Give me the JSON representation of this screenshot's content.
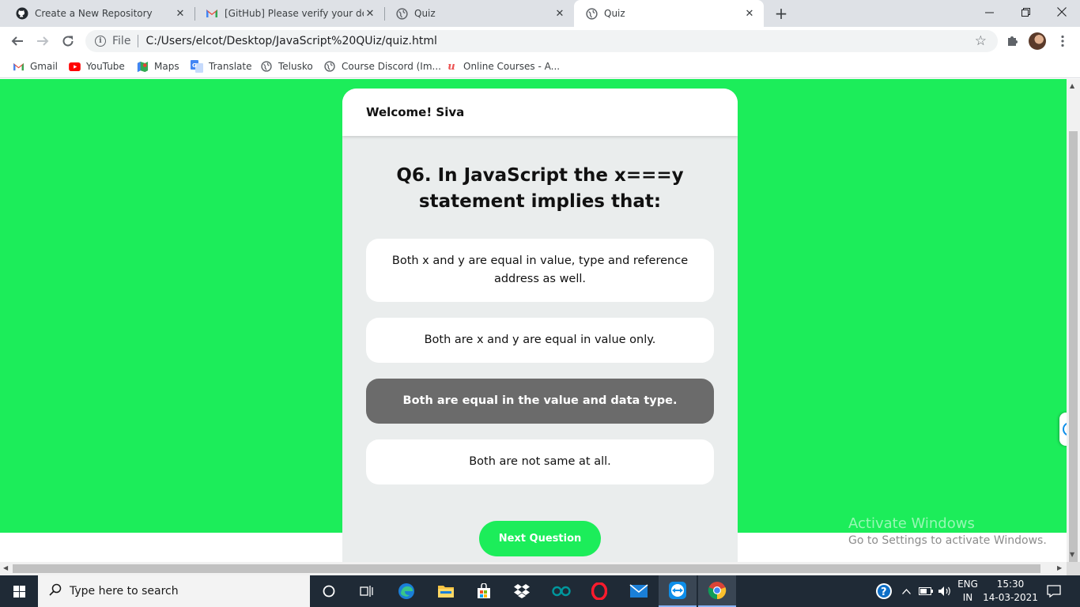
{
  "browser": {
    "tabs": [
      {
        "title": "Create a New Repository",
        "icon": "github-icon"
      },
      {
        "title": "[GitHub] Please verify your device",
        "icon": "gmail-icon"
      },
      {
        "title": "Quiz",
        "icon": "globe-icon"
      },
      {
        "title": "Quiz",
        "icon": "globe-icon",
        "active": true
      }
    ],
    "address": {
      "protocol": "File",
      "url": "C:/Users/elcot/Desktop/JavaScript%20QUiz/quiz.html"
    },
    "bookmarks": [
      {
        "label": "Gmail",
        "icon": "gmail-icon"
      },
      {
        "label": "YouTube",
        "icon": "youtube-icon"
      },
      {
        "label": "Maps",
        "icon": "maps-icon"
      },
      {
        "label": "Translate",
        "icon": "translate-icon"
      },
      {
        "label": "Telusko",
        "icon": "globe-icon"
      },
      {
        "label": "Course Discord (Im...",
        "icon": "globe-icon"
      },
      {
        "label": "Online Courses - A...",
        "icon": "udemy-icon"
      }
    ]
  },
  "quiz": {
    "welcome": "Welcome! Siva",
    "question": "Q6. In JavaScript the x===y statement implies that:",
    "options": [
      "Both x and y are equal in value, type and reference address as well.",
      "Both are x and y are equal in value only.",
      "Both are equal in the value and data type.",
      "Both are not same at all."
    ],
    "selected_option_index": 2,
    "next_label": "Next Question",
    "colors": {
      "page_background": "#1ced5a",
      "card_background": "#eaeded",
      "selected_option": "#6b6b6b",
      "button": "#1ced5a"
    }
  },
  "overlay": {
    "activate_title": "Activate Windows",
    "activate_subtitle": "Go to Settings to activate Windows."
  },
  "taskbar": {
    "search_placeholder": "Type here to search",
    "language": "ENG",
    "region": "IN",
    "time": "15:30",
    "date": "14-03-2021"
  }
}
